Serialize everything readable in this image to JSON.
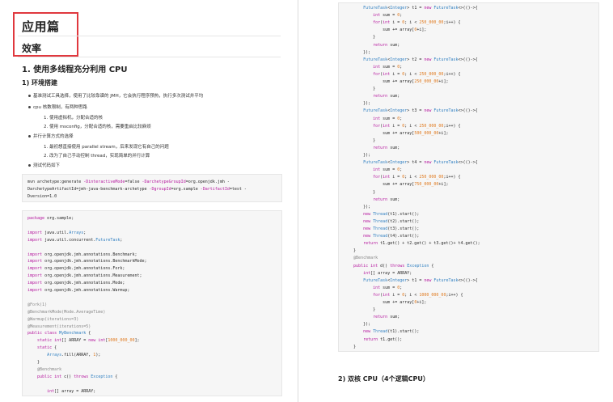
{
  "left": {
    "title": "应用篇",
    "subtitle": "效率",
    "section": "1. 使用多线程充分利用 CPU",
    "subsection": "1) 环境搭建",
    "bullets": [
      "基准测试工具选择，使用了比较靠谱的 JMH，它会执行程序预热，执行多次测试并平均",
      "cpu 核数限制，有两种思路",
      "并行计算方式的选择",
      "测试代码如下"
    ],
    "sub1": [
      "1. 使用虚拟机，分配合适的核",
      "2. 使用 msconfig，分配合适的核，需要重启比较麻烦"
    ],
    "sub2": [
      "1. 最初想直接使用 parallel stream，后来发现它有自己的问题",
      "2. 改为了自己手动控制 thread，实现简单的并行计算"
    ],
    "mvn_lines": [
      "mvn archetype:generate -DinteractiveMode=false -DarchetypeGroupId=org.openjdk.jmh -",
      "DarchetypeArtifactId=jmh-java-benchmark-archetype -DgroupId=org.sample -DartifactId=test -",
      "Dversion=1.0"
    ],
    "code_lines": [
      "package org.sample;",
      "",
      "import java.util.Arrays;",
      "import java.util.concurrent.FutureTask;",
      "",
      "import org.openjdk.jmh.annotations.Benchmark;",
      "import org.openjdk.jmh.annotations.BenchmarkMode;",
      "import org.openjdk.jmh.annotations.Fork;",
      "import org.openjdk.jmh.annotations.Measurement;",
      "import org.openjdk.jmh.annotations.Mode;",
      "import org.openjdk.jmh.annotations.Warmup;",
      "",
      "@Fork(1)",
      "@BenchmarkMode(Mode.AverageTime)",
      "@Warmup(iterations=3)",
      "@Measurement(iterations=5)",
      "public class MyBenchmark {",
      "    static int[] ARRAY = new int[1000_000_00];",
      "    static {",
      "        Arrays.fill(ARRAY, 1);",
      "    }",
      "    @Benchmark",
      "    public int c() throws Exception {",
      "",
      "        int[] array = ARRAY;"
    ]
  },
  "right": {
    "code_lines": [
      "        FutureTask<Integer> t1 = new FutureTask<>(()->{",
      "            int sum = 0;",
      "            for(int i = 0; i < 250_000_00;i++) {",
      "                sum += array[0+i];",
      "            }",
      "            return sum;",
      "        });",
      "        FutureTask<Integer> t2 = new FutureTask<>(()->{",
      "            int sum = 0;",
      "            for(int i = 0; i < 250_000_00;i++) {",
      "                sum += array[250_000_00+i];",
      "            }",
      "            return sum;",
      "        });",
      "        FutureTask<Integer> t3 = new FutureTask<>(()->{",
      "            int sum = 0;",
      "            for(int i = 0; i < 250_000_00;i++) {",
      "                sum += array[500_000_00+i];",
      "            }",
      "            return sum;",
      "        });",
      "        FutureTask<Integer> t4 = new FutureTask<>(()->{",
      "            int sum = 0;",
      "            for(int i = 0; i < 250_000_00;i++) {",
      "                sum += array[750_000_00+i];",
      "            }",
      "            return sum;",
      "        });",
      "        new Thread(t1).start();",
      "        new Thread(t2).start();",
      "        new Thread(t3).start();",
      "        new Thread(t4).start();",
      "        return t1.get() + t2.get() + t3.get()+ t4.get();",
      "    }",
      "    @Benchmark",
      "    public int d() throws Exception {",
      "        int[] array = ARRAY;",
      "        FutureTask<Integer> t1 = new FutureTask<>(()->{",
      "            int sum = 0;",
      "            for(int i = 0; i < 1000_000_00;i++) {",
      "                sum += array[0+i];",
      "            }",
      "            return sum;",
      "        });",
      "        new Thread(t1).start();",
      "        return t1.get();",
      "    }",
      "}"
    ],
    "heading": "2) 双核 CPU（4个逻辑CPU）"
  }
}
